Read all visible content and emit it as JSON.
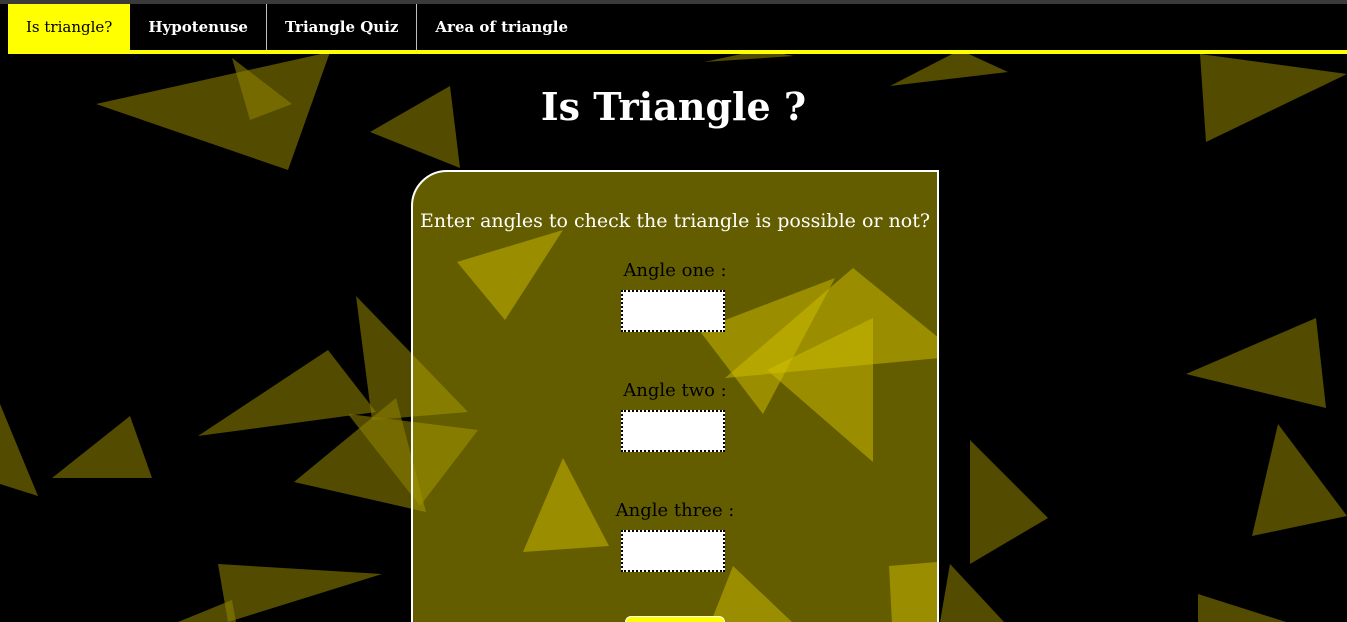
{
  "nav": {
    "items": [
      {
        "label": "Is triangle?",
        "active": true
      },
      {
        "label": "Hypotenuse",
        "active": false
      },
      {
        "label": "Triangle Quiz",
        "active": false
      },
      {
        "label": "Area of triangle",
        "active": false
      }
    ]
  },
  "page": {
    "title": "Is Triangle ?"
  },
  "form": {
    "prompt": "Enter angles to check the triangle is possible or not?",
    "angle_one_label": "Angle one :",
    "angle_one_value": "",
    "angle_two_label": "Angle two :",
    "angle_two_value": "",
    "angle_three_label": "Angle three :",
    "angle_three_value": ""
  },
  "colors": {
    "accent": "#ffff00",
    "background": "#000000",
    "card": "#6b6200",
    "triangle": "#b3a500"
  }
}
